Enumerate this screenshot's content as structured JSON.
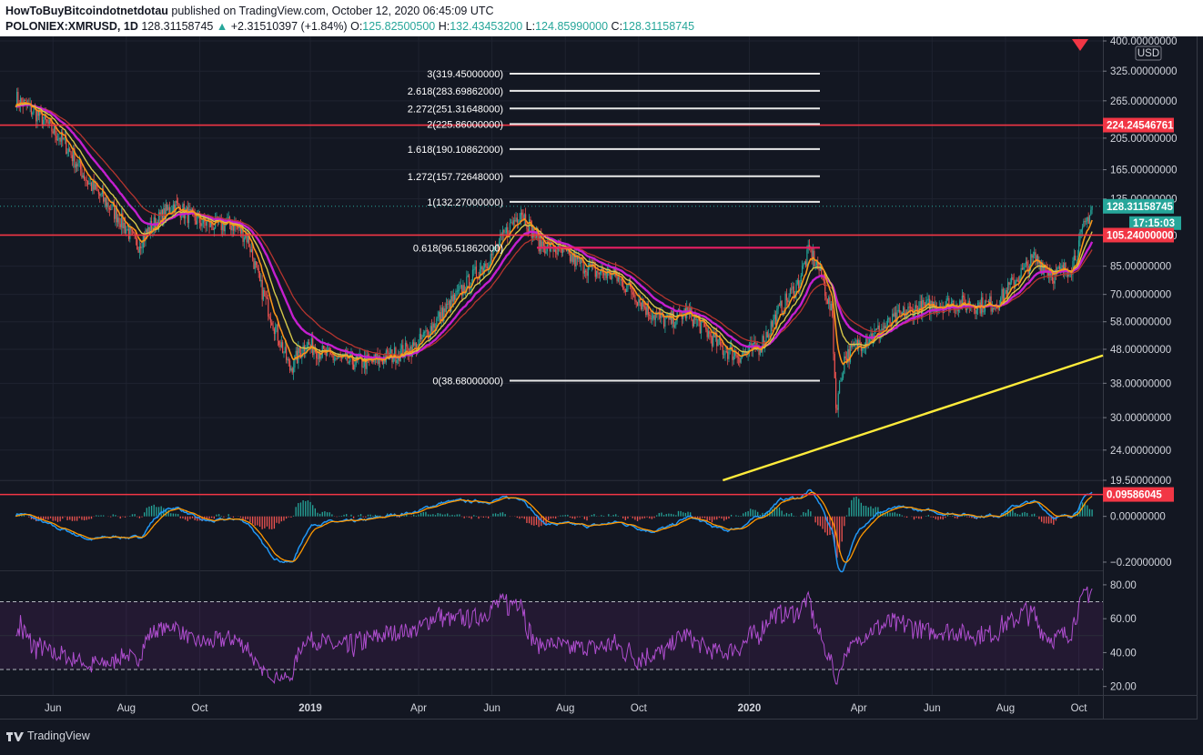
{
  "header": {
    "author": "HowToBuyBitcoindotnetdotau",
    "published": "published on TradingView.com, October 12, 2020 06:45:09 UTC",
    "symbol": "POLONIEX:XMRUSD, 1D",
    "last": "128.31158745",
    "change": "+2.31510397 (+1.84%)",
    "open_label": "O:",
    "open": "125.82500500",
    "high_label": "H:",
    "high": "132.43453200",
    "low_label": "L:",
    "low": "124.85990000",
    "close_label": "C:",
    "close": "128.31158745"
  },
  "footer": {
    "brand": "TradingView"
  },
  "colors": {
    "background": "#131722",
    "up": "#26a69a",
    "down": "#ef5350",
    "ma_purple": "#c51fcf",
    "ma_orange": "#f7931a",
    "ma_yellow": "#d6c84a",
    "ma_red": "#b5342f",
    "trendline": "#ffeb3b",
    "resistance": "#f23645",
    "macd": "#2196f3",
    "signal": "#ff9800",
    "rsi": "#9c27b0"
  },
  "chart_data": [
    {
      "type": "line",
      "panel": "price",
      "scale": "log",
      "currency": "USD",
      "x_ticks": [
        "Jun",
        "Aug",
        "Oct",
        "2019",
        "Apr",
        "Jun",
        "Aug",
        "Oct",
        "2020",
        "Apr",
        "Jun",
        "Aug",
        "Oct"
      ],
      "y_ticks": [
        "400.00000000",
        "325.00000000",
        "265.00000000",
        "205.00000000",
        "165.00000000",
        "135.00000000",
        "105.00000000",
        "85.00000000",
        "70.00000000",
        "58.00000000",
        "48.00000000",
        "38.00000000",
        "30.00000000",
        "24.00000000",
        "19.50000000"
      ],
      "ylim": [
        19.5,
        400
      ],
      "series": [
        {
          "name": "XMRUSD",
          "x": [
            "2018-05-01",
            "2018-05-20",
            "2018-06-10",
            "2018-07-01",
            "2018-07-25",
            "2018-08-10",
            "2018-08-20",
            "2018-09-10",
            "2018-09-25",
            "2018-10-10",
            "2018-10-30",
            "2018-11-10",
            "2018-11-20",
            "2018-12-01",
            "2018-12-15",
            "2018-12-28",
            "2019-01-15",
            "2019-02-01",
            "2019-02-20",
            "2019-03-10",
            "2019-03-30",
            "2019-04-15",
            "2019-05-01",
            "2019-05-15",
            "2019-06-01",
            "2019-06-15",
            "2019-06-25",
            "2019-07-10",
            "2019-07-25",
            "2019-08-10",
            "2019-08-25",
            "2019-09-10",
            "2019-09-25",
            "2019-10-10",
            "2019-10-25",
            "2019-11-10",
            "2019-11-25",
            "2019-12-10",
            "2019-12-25",
            "2020-01-10",
            "2020-01-25",
            "2020-02-10",
            "2020-02-20",
            "2020-03-01",
            "2020-03-10",
            "2020-03-13",
            "2020-03-20",
            "2020-04-01",
            "2020-04-20",
            "2020-05-10",
            "2020-06-01",
            "2020-06-20",
            "2020-07-10",
            "2020-07-25",
            "2020-08-10",
            "2020-08-25",
            "2020-09-10",
            "2020-09-25",
            "2020-10-05",
            "2020-10-12"
          ],
          "y": [
            270,
            240,
            200,
            150,
            120,
            98,
            110,
            130,
            118,
            113,
            113,
            103,
            75,
            58,
            42,
            50,
            46,
            44,
            44,
            46,
            49,
            58,
            68,
            78,
            92,
            110,
            125,
            100,
            95,
            88,
            82,
            80,
            72,
            62,
            58,
            62,
            55,
            48,
            46,
            49,
            62,
            75,
            95,
            80,
            60,
            32,
            45,
            50,
            55,
            62,
            65,
            66,
            65,
            66,
            78,
            90,
            80,
            85,
            110,
            128.31
          ]
        }
      ],
      "fibonacci": {
        "levels": [
          {
            "label": "3(319.45000000)",
            "value": 319.45
          },
          {
            "label": "2.618(283.69862000)",
            "value": 283.69862
          },
          {
            "label": "2.272(251.31648000)",
            "value": 251.31648
          },
          {
            "label": "2(225.86000000)",
            "value": 225.86
          },
          {
            "label": "1.618(190.10862000)",
            "value": 190.10862
          },
          {
            "label": "1.272(157.72648000)",
            "value": 157.72648
          },
          {
            "label": "1(132.27000000)",
            "value": 132.27
          },
          {
            "label": "0.618(96.51862000)",
            "value": 96.51862
          },
          {
            "label": "0(38.68000000)",
            "value": 38.68
          }
        ]
      },
      "horizontal_lines": [
        224.24546761,
        105.24
      ],
      "price_tags": [
        {
          "label": "224.24546761",
          "value": 224.24546761,
          "kind": "level"
        },
        {
          "label": "128.31158745",
          "value": 128.31158745,
          "kind": "last"
        },
        {
          "label": "17:15:03",
          "value": 120,
          "kind": "countdown"
        },
        {
          "label": "105.24000000",
          "value": 105.24,
          "kind": "level"
        }
      ],
      "currency_badge": "USD"
    },
    {
      "type": "bar",
      "panel": "macd",
      "y_ticks": [
        "0.00000000",
        "−0.20000000"
      ],
      "ylim": [
        -0.22,
        0.13
      ],
      "horizontal_line": 0.09586045,
      "price_tag": "0.09586045"
    },
    {
      "type": "line",
      "panel": "rsi",
      "y_ticks": [
        "80.00",
        "60.00",
        "40.00",
        "20.00"
      ],
      "ylim": [
        15,
        88
      ],
      "bands": [
        30,
        70
      ]
    }
  ]
}
